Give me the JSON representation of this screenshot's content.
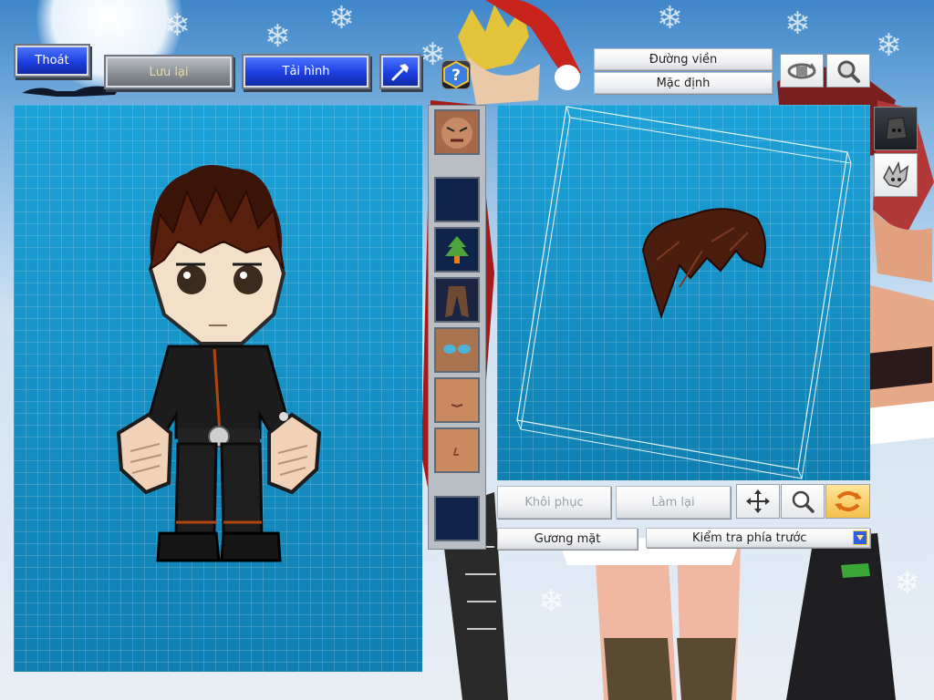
{
  "toolbar": {
    "exit_label": "Thoát",
    "save_label": "Lưu lại",
    "reload_label": "Tải hình"
  },
  "right_top": {
    "outline_label": "Đường viền",
    "default_label": "Mặc định"
  },
  "editor": {
    "restore_label": "Khôi phục",
    "redo_label": "Làm lại",
    "face_label": "Gương mặt",
    "view_select_value": "Kiểm tra phía trước"
  },
  "icons": {
    "hammer": "hammer-icon",
    "help": "help-icon",
    "rotate": "rotate-view-icon",
    "zoom": "zoom-icon",
    "move": "move-icon",
    "swap": "swap-icon"
  },
  "colors": {
    "grid_blue": "#1a8cbd",
    "button_blue": "#1d3ee0",
    "hair_brown": "#4a1d0e"
  }
}
